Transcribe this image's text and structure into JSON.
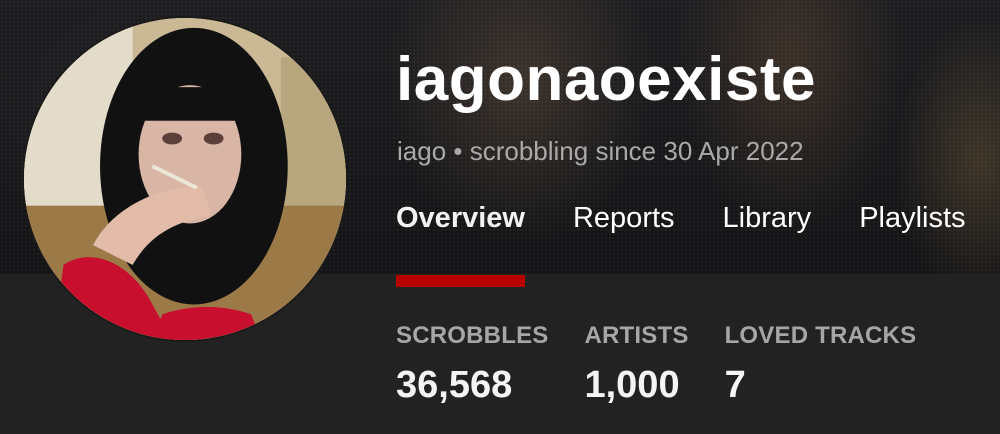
{
  "profile": {
    "username": "iagonaoexiste",
    "subtitle": "iago • scrobbling since 30 Apr 2022",
    "avatar_alt": "profile avatar"
  },
  "nav": {
    "tabs": [
      {
        "label": "Overview",
        "active": true
      },
      {
        "label": "Reports",
        "active": false
      },
      {
        "label": "Library",
        "active": false
      },
      {
        "label": "Playlists",
        "active": false
      }
    ]
  },
  "stats": [
    {
      "label": "SCROBBLES",
      "value": "36,568"
    },
    {
      "label": "ARTISTS",
      "value": "1,000"
    },
    {
      "label": "LOVED TRACKS",
      "value": "7"
    }
  ],
  "colors": {
    "accent": "#b90000",
    "background": "#222222",
    "muted_text": "#a9a9a9"
  }
}
